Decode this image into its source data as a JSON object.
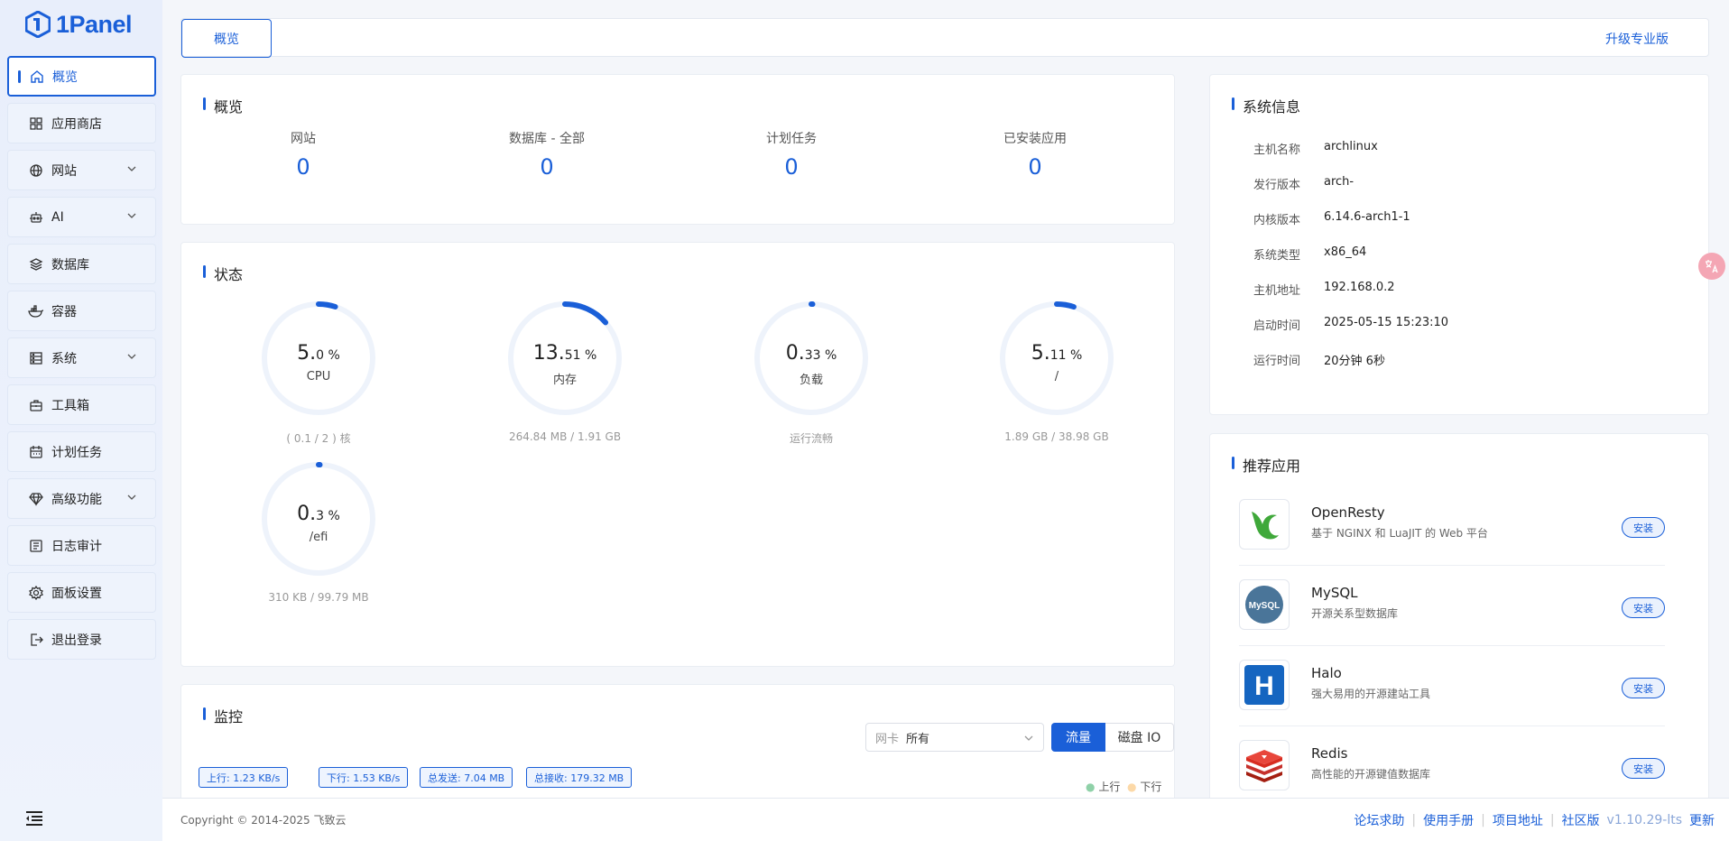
{
  "logo": {
    "text": "1Panel"
  },
  "sidebar": {
    "items": [
      {
        "label": "概览",
        "icon": "home-icon"
      },
      {
        "label": "应用商店",
        "icon": "grid-icon"
      },
      {
        "label": "网站",
        "icon": "globe-icon"
      },
      {
        "label": "AI",
        "icon": "robot-icon"
      },
      {
        "label": "数据库",
        "icon": "layers-icon"
      },
      {
        "label": "容器",
        "icon": "docker-icon"
      },
      {
        "label": "系统",
        "icon": "server-icon"
      },
      {
        "label": "工具箱",
        "icon": "toolbox-icon"
      },
      {
        "label": "计划任务",
        "icon": "calendar-icon"
      },
      {
        "label": "高级功能",
        "icon": "diamond-icon"
      },
      {
        "label": "日志审计",
        "icon": "log-icon"
      },
      {
        "label": "面板设置",
        "icon": "gear-icon"
      },
      {
        "label": "退出登录",
        "icon": "logout-icon"
      }
    ]
  },
  "topbar": {
    "tab": "概览",
    "upgrade": "升级专业版"
  },
  "overview": {
    "title": "概览",
    "stats": [
      {
        "label": "网站",
        "value": "0"
      },
      {
        "label": "数据库 - 全部",
        "value": "0"
      },
      {
        "label": "计划任务",
        "value": "0"
      },
      {
        "label": "已安装应用",
        "value": "0"
      }
    ]
  },
  "status": {
    "title": "状态",
    "gauges": [
      {
        "int": "5.",
        "dec": "0 %",
        "label": "CPU",
        "sub": "( 0.1 / 2 ) 核",
        "percent": 5.0
      },
      {
        "int": "13.",
        "dec": "51 %",
        "label": "内存",
        "sub": "264.84 MB / 1.91 GB",
        "percent": 13.51
      },
      {
        "int": "0.",
        "dec": "33 %",
        "label": "负载",
        "sub": "运行流畅",
        "percent": 0.33
      },
      {
        "int": "5.",
        "dec": "11 %",
        "label": "/",
        "sub": "1.89 GB / 38.98 GB",
        "percent": 5.11
      },
      {
        "int": "0.",
        "dec": "3 %",
        "label": "/efi",
        "sub": "310 KB / 99.79 MB",
        "percent": 0.3
      }
    ]
  },
  "sysinfo": {
    "title": "系统信息",
    "rows": [
      {
        "k": "主机名称",
        "v": "archlinux"
      },
      {
        "k": "发行版本",
        "v": "arch-"
      },
      {
        "k": "内核版本",
        "v": "6.14.6-arch1-1"
      },
      {
        "k": "系统类型",
        "v": "x86_64"
      },
      {
        "k": "主机地址",
        "v": "192.168.0.2"
      },
      {
        "k": "启动时间",
        "v": "2025-05-15 15:23:10"
      },
      {
        "k": "运行时间",
        "v": "20分钟 6秒"
      }
    ]
  },
  "apps": {
    "title": "推荐应用",
    "install": "安装",
    "items": [
      {
        "name": "OpenResty",
        "desc": "基于 NGINX 和 LuaJIT 的 Web 平台"
      },
      {
        "name": "MySQL",
        "desc": "开源关系型数据库"
      },
      {
        "name": "Halo",
        "desc": "强大易用的开源建站工具"
      },
      {
        "name": "Redis",
        "desc": "高性能的开源键值数据库"
      }
    ]
  },
  "monitor": {
    "title": "监控",
    "nic_label": "网卡",
    "nic_value": "所有",
    "tab_flow": "流量",
    "tab_disk": "磁盘 IO",
    "tags": [
      "上行: 1.23 KB/s",
      "下行: 1.53 KB/s",
      "总发送: 7.04 MB",
      "总接收: 179.32 MB"
    ],
    "legend": [
      "上行",
      "下行"
    ]
  },
  "footer": {
    "copyright": "Copyright © 2014-2025 飞致云",
    "links": [
      "论坛求助",
      "使用手册",
      "项目地址",
      "社区版"
    ],
    "version": "v1.10.29-lts",
    "update": "更新"
  },
  "colors": {
    "accent": "#1a5fd8",
    "gauge_track": "#eef3fb"
  }
}
